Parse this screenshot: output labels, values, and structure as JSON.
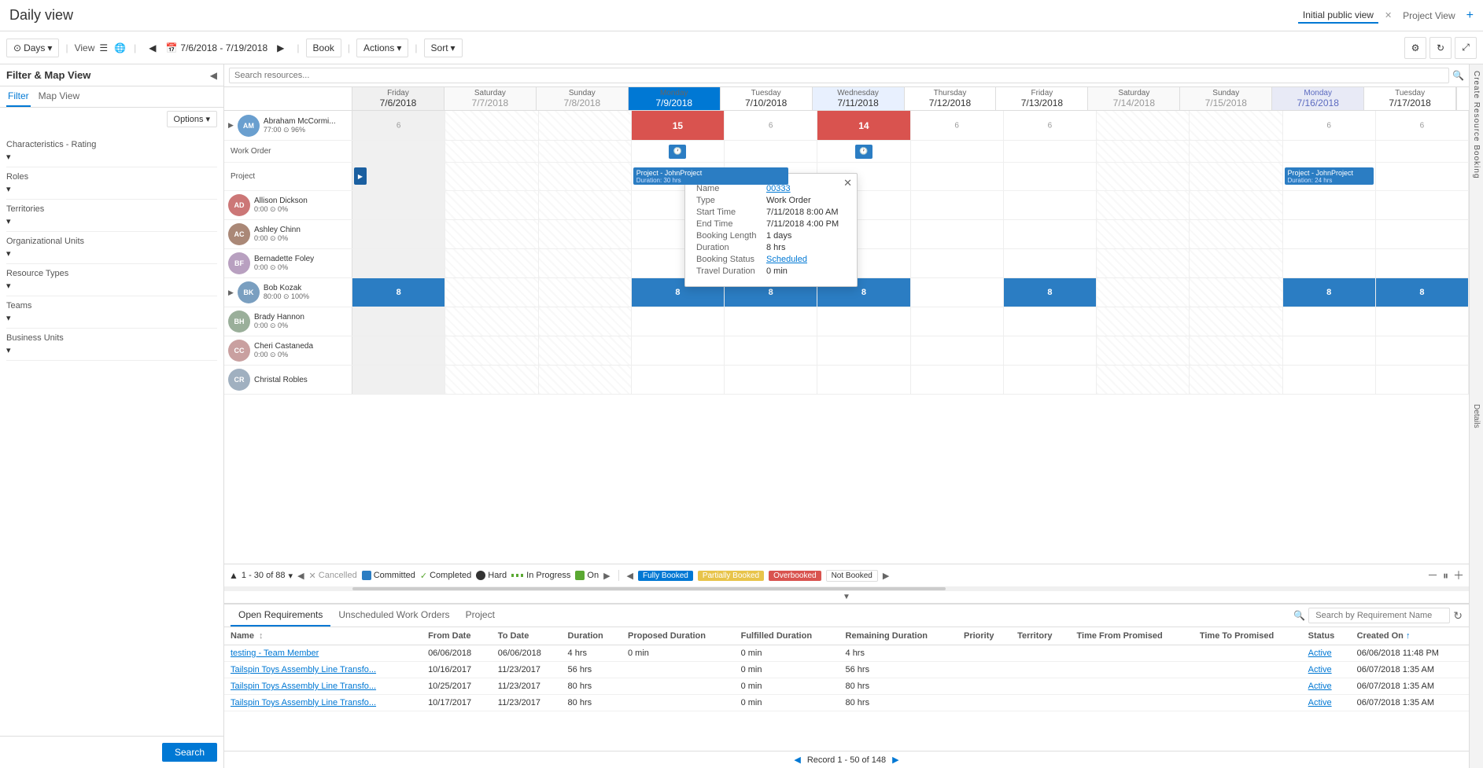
{
  "app": {
    "title": "Daily view"
  },
  "tabs": {
    "active": "Initial public view",
    "items": [
      "Initial public view",
      "Project View"
    ],
    "add_label": "+"
  },
  "toolbar": {
    "view_mode": "Days",
    "view_label": "View",
    "date_range": "7/6/2018 - 7/19/2018",
    "book_label": "Book",
    "actions_label": "Actions",
    "sort_label": "Sort"
  },
  "filter_panel": {
    "title": "Filter & Map View",
    "tabs": [
      "Filter",
      "Map View"
    ],
    "active_tab": "Filter",
    "filter_label": "Filter",
    "options_label": "Options",
    "sections": [
      {
        "label": "Characteristics - Rating"
      },
      {
        "label": "Roles"
      },
      {
        "label": "Territories"
      },
      {
        "label": "Organizational Units"
      },
      {
        "label": "Resource Types"
      },
      {
        "label": "Teams"
      },
      {
        "label": "Business Units"
      }
    ],
    "search_label": "Search"
  },
  "calendar": {
    "resource_search_placeholder": "Search resources...",
    "dates": [
      {
        "date": "7/6/2018",
        "day": "Friday",
        "num": "",
        "weekend": false
      },
      {
        "date": "7/7/2018",
        "day": "Saturday",
        "num": "",
        "weekend": true
      },
      {
        "date": "7/8/2018",
        "day": "Sunday",
        "num": "",
        "weekend": true
      },
      {
        "date": "7/9/2018",
        "day": "Monday",
        "num": "",
        "weekend": false,
        "today": true
      },
      {
        "date": "7/10/2018",
        "day": "Tuesday",
        "num": "",
        "weekend": false
      },
      {
        "date": "7/11/2018",
        "day": "Wednesday",
        "num": "",
        "weekend": false,
        "holiday": true
      },
      {
        "date": "7/12/2018",
        "day": "Thursday",
        "num": "",
        "weekend": false
      },
      {
        "date": "7/13/2018",
        "day": "Friday",
        "num": "",
        "weekend": false
      },
      {
        "date": "7/14/2018",
        "day": "Saturday",
        "num": "",
        "weekend": true
      },
      {
        "date": "7/15/2018",
        "day": "Sunday",
        "num": "",
        "weekend": true
      },
      {
        "date": "7/16/2018",
        "day": "Monday",
        "num": "",
        "weekend": false
      },
      {
        "date": "7/17/2018",
        "day": "Tuesday",
        "num": "",
        "weekend": false
      }
    ],
    "resources": [
      {
        "name": "Abraham McCormi...",
        "meta": "77:00  96%",
        "initials": "AM",
        "color": "#5a8fc3",
        "bookings": [
          {
            "col": 0,
            "value": "6",
            "type": "num"
          },
          {
            "col": 3,
            "value": "15",
            "type": "red"
          },
          {
            "col": 4,
            "value": "6",
            "type": "num"
          },
          {
            "col": 5,
            "value": "14",
            "type": "red"
          },
          {
            "col": 6,
            "value": "6",
            "type": "num"
          },
          {
            "col": 7,
            "value": "6",
            "type": "num"
          },
          {
            "col": 10,
            "value": "6",
            "type": "num"
          },
          {
            "col": 11,
            "value": "6",
            "type": "num"
          }
        ],
        "subrows": [
          {
            "label": "Work Order",
            "bookings": [
              {
                "col": 3,
                "has_clock": true,
                "type": "small-blue"
              },
              {
                "col": 5,
                "has_clock": true,
                "type": "small-blue"
              }
            ]
          },
          {
            "label": "Project",
            "bookings": [
              {
                "col": 0,
                "type": "small-blue-sm"
              },
              {
                "col": 3,
                "value": "Project - JohnProject\nDuration: 30 hrs",
                "type": "project-bar",
                "span": 2
              },
              {
                "col": 10,
                "value": "Project - JohnProject\nDuration: 24 hrs",
                "type": "project-bar"
              }
            ]
          }
        ]
      },
      {
        "name": "Allison Dickson",
        "meta": "0:00  0%",
        "initials": "AD",
        "color": "#c77"
      },
      {
        "name": "Ashley Chinn",
        "meta": "0:00  0%",
        "initials": "AC",
        "color": "#a87"
      },
      {
        "name": "Bernadette Foley",
        "meta": "0:00  0%",
        "initials": "BF",
        "color": "#b8a0c0"
      },
      {
        "name": "Bob Kozak",
        "meta": "80:00  100%",
        "initials": "BK",
        "color": "#7a9fc0",
        "bookings": [
          {
            "col": 0,
            "value": "8",
            "type": "blue"
          },
          {
            "col": 3,
            "value": "8",
            "type": "blue"
          },
          {
            "col": 4,
            "value": "8",
            "type": "blue"
          },
          {
            "col": 5,
            "value": "8?",
            "type": "blue"
          },
          {
            "col": 7,
            "value": "8",
            "type": "blue"
          },
          {
            "col": 10,
            "value": "8",
            "type": "blue"
          },
          {
            "col": 11,
            "value": "8",
            "type": "blue"
          }
        ]
      },
      {
        "name": "Brady Hannon",
        "meta": "0:00  0%",
        "initials": "BH",
        "color": "#9aaf9a"
      },
      {
        "name": "Cheri Castaneda",
        "meta": "0:00  0%",
        "initials": "CC",
        "color": "#c9a0a0"
      },
      {
        "name": "Christal Robles",
        "meta": "",
        "initials": "CR",
        "color": "#a0b0c0"
      }
    ],
    "pagination": "1 - 30 of 88"
  },
  "legend": {
    "cancelled": "Cancelled",
    "committed": "Committed",
    "completed": "Completed",
    "hard": "Hard",
    "in_progress": "In Progress",
    "on": "On",
    "fully_booked": "Fully Booked",
    "partially_booked": "Partially Booked",
    "overbooked": "Overbooked",
    "not_booked": "Not Booked"
  },
  "popup": {
    "name_label": "Name",
    "name_value": "00333",
    "type_label": "Type",
    "type_value": "Work Order",
    "start_label": "Start Time",
    "start_value": "7/11/2018 8:00 AM",
    "end_label": "End Time",
    "end_value": "7/11/2018 4:00 PM",
    "booking_length_label": "Booking Length",
    "booking_length_value": "1 days",
    "duration_label": "Duration",
    "duration_value": "8 hrs",
    "booking_status_label": "Booking Status",
    "booking_status_value": "Scheduled",
    "travel_label": "Travel Duration",
    "travel_value": "0 min"
  },
  "bottom_panel": {
    "tabs": [
      "Open Requirements",
      "Unscheduled Work Orders",
      "Project"
    ],
    "active_tab": "Open Requirements",
    "search_placeholder": "Search by Requirement Name",
    "columns": [
      "Name",
      "From Date",
      "To Date",
      "Duration",
      "Proposed Duration",
      "Fulfilled Duration",
      "Remaining Duration",
      "Priority",
      "Territory",
      "Time From Promised",
      "Time To Promised",
      "Status",
      "Created On"
    ],
    "rows": [
      {
        "name": "testing - Team Member",
        "from_date": "06/06/2018",
        "to_date": "06/06/2018",
        "duration": "4 hrs",
        "proposed": "0 min",
        "fulfilled": "0 min",
        "remaining": "4 hrs",
        "priority": "",
        "territory": "",
        "time_from": "",
        "time_to": "",
        "status": "Active",
        "created": "06/06/2018 11:48 PM"
      },
      {
        "name": "Tailspin Toys Assembly Line Transfo...",
        "from_date": "10/16/2017",
        "to_date": "11/23/2017",
        "duration": "56 hrs",
        "proposed": "",
        "fulfilled": "0 min",
        "remaining": "56 hrs",
        "priority": "",
        "territory": "",
        "time_from": "",
        "time_to": "",
        "status": "Active",
        "created": "06/07/2018 1:35 AM"
      },
      {
        "name": "Tailspin Toys Assembly Line Transfo...",
        "from_date": "10/25/2017",
        "to_date": "11/23/2017",
        "duration": "80 hrs",
        "proposed": "",
        "fulfilled": "0 min",
        "remaining": "80 hrs",
        "priority": "",
        "territory": "",
        "time_from": "",
        "time_to": "",
        "status": "Active",
        "created": "06/07/2018 1:35 AM"
      },
      {
        "name": "Tailspin Toys Assembly Line Transfo...",
        "from_date": "10/17/2017",
        "to_date": "11/23/2017",
        "duration": "80 hrs",
        "proposed": "",
        "fulfilled": "0 min",
        "remaining": "80 hrs",
        "priority": "",
        "territory": "",
        "time_from": "",
        "time_to": "",
        "status": "Active",
        "created": "06/07/2018 1:35 AM"
      }
    ],
    "record_info": "Record 1 - 50 of 148"
  },
  "details_panel": {
    "label": "Details"
  },
  "create_booking_label": "Create Resource Booking"
}
